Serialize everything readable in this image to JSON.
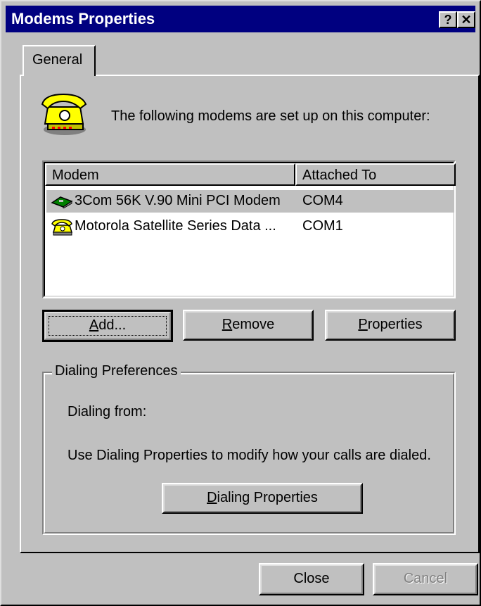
{
  "window": {
    "title": "Modems Properties",
    "help_button": "?",
    "close_button": "✕"
  },
  "tabs": [
    {
      "label": "General"
    }
  ],
  "intro_text": "The following modems are set up on this computer:",
  "list": {
    "columns": [
      "Modem",
      "Attached To"
    ],
    "rows": [
      {
        "modem": "3Com 56K V.90 Mini PCI Modem",
        "attached_to": "COM4",
        "selected": true
      },
      {
        "modem": "Motorola Satellite Series Data ...",
        "attached_to": "COM1",
        "selected": false
      }
    ]
  },
  "buttons": {
    "add": {
      "prefix": "",
      "accel": "A",
      "rest": "dd..."
    },
    "remove": {
      "prefix": "",
      "accel": "R",
      "rest": "emove"
    },
    "properties": {
      "prefix": "",
      "accel": "P",
      "rest": "roperties"
    }
  },
  "dialing": {
    "group_title": "Dialing Preferences",
    "from_label": "Dialing from:",
    "info_text": "Use Dialing Properties to modify how your calls are dialed.",
    "button": {
      "accel": "D",
      "rest": "ialing Properties"
    }
  },
  "footer": {
    "close_label": "Close",
    "cancel_label": "Cancel"
  }
}
